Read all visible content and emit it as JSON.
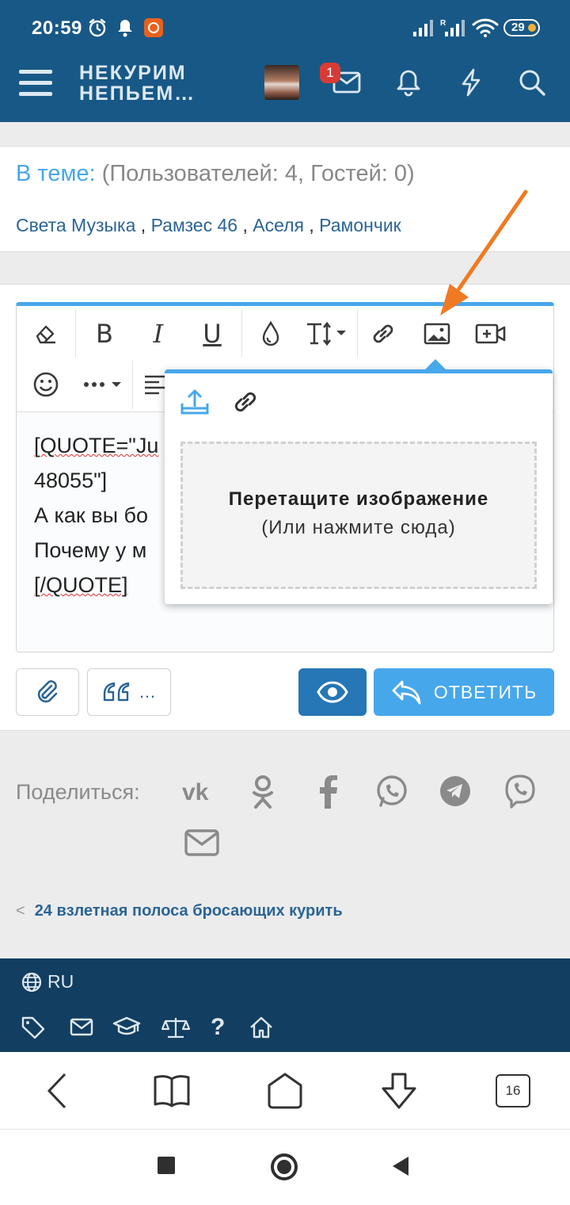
{
  "status_bar": {
    "time": "20:59",
    "battery": "29",
    "icons": [
      "alarm-icon",
      "notification-bell-icon",
      "app-notification-icon",
      "signal-icon",
      "signal-roaming-icon",
      "wifi-icon",
      "battery-icon"
    ]
  },
  "header": {
    "logo_line1": "НЕКУРИМ",
    "logo_line2": "НЕПЬЕМ…",
    "unread_badge": "1",
    "brand_color": "#185886"
  },
  "online": {
    "label": "В теме:",
    "counts": "(Пользователей: 4, Гостей: 0)",
    "users": [
      "Света Музыка",
      "Рамзес 46",
      "Аселя",
      "Рамончик"
    ],
    "separator": " , "
  },
  "editor": {
    "lines": [
      "[QUOTE=\"Ju",
      "48055\"]",
      "А как вы бо",
      "Почему у м",
      "[/QUOTE]"
    ],
    "toolbar_icons": [
      "eraser-icon",
      "bold-icon",
      "italic-icon",
      "underline-icon",
      "color-drop-icon",
      "text-size-icon",
      "link-icon",
      "image-icon",
      "video-icon",
      "emoji-icon",
      "more-icon",
      "align-icon"
    ]
  },
  "image_popup": {
    "drop_title": "Перетащите изображение",
    "drop_subtitle": "(Или нажмите сюда)"
  },
  "buttons": {
    "quote_more": "…",
    "reply": "ОТВЕТИТЬ"
  },
  "share": {
    "label": "Поделиться:",
    "networks": [
      "vk-icon",
      "odnoklassniki-icon",
      "facebook-icon",
      "whatsapp-icon",
      "telegram-icon",
      "viber-icon",
      "email-icon"
    ]
  },
  "back_link": {
    "chevron": "<",
    "text": "24 взлетная полоса бросающих курить"
  },
  "footer": {
    "lang": "RU"
  },
  "browser": {
    "tab_count": "16"
  },
  "colors": {
    "accent": "#47a7eb",
    "link": "#2b6496",
    "footer_bg": "#123e62",
    "annotation_arrow": "#f07a22"
  }
}
